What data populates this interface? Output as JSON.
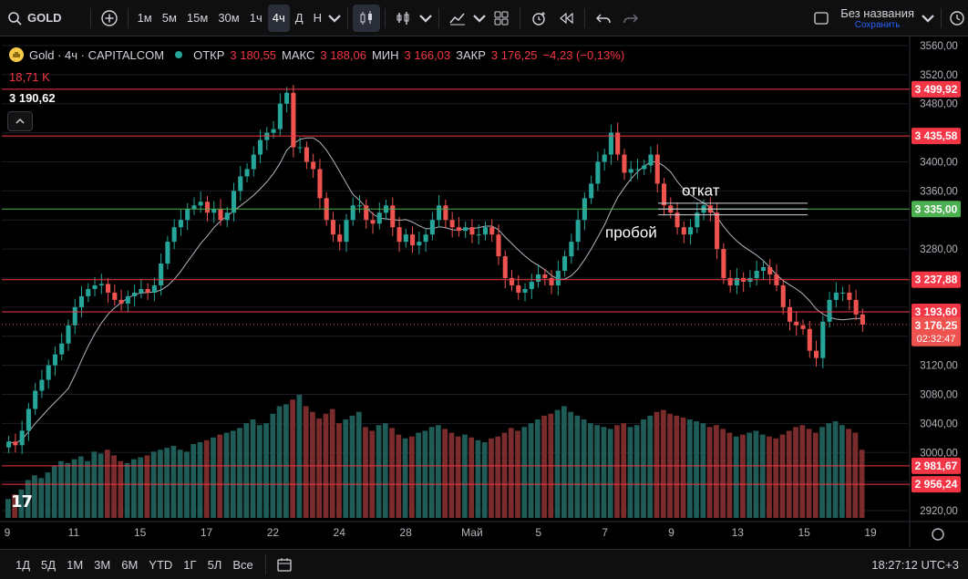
{
  "toolbar": {
    "symbol": "GOLD",
    "intervals": [
      "1м",
      "5м",
      "15м",
      "30м",
      "1ч",
      "4ч",
      "Д",
      "Н"
    ],
    "active_interval": "4ч",
    "layout_name": "Без названия",
    "save_label": "Сохранить"
  },
  "legend": {
    "title": "Gold · 4ч · CAPITALCOM",
    "open_label": "ОТКР",
    "open": "3 180,55",
    "high_label": "МАКС",
    "high": "3 188,06",
    "low_label": "МИН",
    "low": "3 166,03",
    "close_label": "ЗАКР",
    "close": "3 176,25",
    "change": "−4,23 (−0,13%)",
    "volume": "18,71 K",
    "crosshair_price": "3 190,62"
  },
  "annotations": {
    "pullback": "откат",
    "breakout": "пробой"
  },
  "bottom": {
    "ranges": [
      "1Д",
      "5Д",
      "1М",
      "3М",
      "6М",
      "YTD",
      "1Г",
      "5Л",
      "Все"
    ],
    "clock": "18:27:12 UTC+3"
  },
  "colors": {
    "up": "#26a69a",
    "down": "#ef5350",
    "level": "#f23645",
    "green_level": "#4caf50",
    "ma": "#b2b5be"
  },
  "chart_data": {
    "type": "candlestick",
    "y_axis": {
      "ylim": [
        2910,
        3570
      ],
      "ticks": [
        3560,
        3520,
        3480,
        3440,
        3400,
        3360,
        3320,
        3280,
        3240,
        3200,
        3160,
        3120,
        3080,
        3040,
        3000,
        2960,
        2920
      ],
      "tick_labels": [
        "3560,00",
        "3520,00",
        "3480,00",
        "3440,00",
        "3400,00",
        "3360,00",
        "3320,00",
        "3280,00",
        "3240,00",
        "3200,00",
        "3160,00",
        "3120,00",
        "3080,00",
        "3040,00",
        "3000,00",
        "2960,00",
        "2920,00"
      ]
    },
    "x_axis": {
      "labels": [
        "9",
        "11",
        "15",
        "17",
        "22",
        "24",
        "28",
        "Май",
        "5",
        "7",
        "9",
        "13",
        "15",
        "19"
      ]
    },
    "levels": [
      {
        "price": 3499.92,
        "label": "3 499,92",
        "color": "#f23645"
      },
      {
        "price": 3435.58,
        "label": "3 435,58",
        "color": "#f23645"
      },
      {
        "price": 3335.0,
        "label": "3 335,00",
        "color": "#4caf50"
      },
      {
        "price": 3237.88,
        "label": "3 237,88",
        "color": "#f23645"
      },
      {
        "price": 3193.6,
        "label": "3 193,60",
        "color": "#f23645"
      },
      {
        "price": 2981.67,
        "label": "2 981,67",
        "color": "#f23645"
      },
      {
        "price": 2956.24,
        "label": "2 956,24",
        "color": "#f23645"
      }
    ],
    "last_price": {
      "price": 3176.25,
      "label": "3 176,25",
      "countdown": "02:32:47"
    },
    "closes": [
      3015,
      3010,
      3030,
      3060,
      3085,
      3100,
      3120,
      3135,
      3150,
      3175,
      3200,
      3215,
      3225,
      3230,
      3232,
      3220,
      3210,
      3205,
      3215,
      3220,
      3225,
      3220,
      3230,
      3260,
      3290,
      3310,
      3320,
      3335,
      3340,
      3345,
      3330,
      3335,
      3320,
      3330,
      3360,
      3380,
      3390,
      3410,
      3430,
      3440,
      3445,
      3480,
      3495,
      3420,
      3420,
      3400,
      3390,
      3350,
      3320,
      3300,
      3290,
      3320,
      3340,
      3340,
      3320,
      3315,
      3330,
      3340,
      3310,
      3290,
      3300,
      3285,
      3290,
      3300,
      3320,
      3340,
      3320,
      3310,
      3305,
      3310,
      3300,
      3300,
      3310,
      3300,
      3270,
      3240,
      3230,
      3220,
      3225,
      3235,
      3245,
      3240,
      3230,
      3250,
      3270,
      3290,
      3320,
      3350,
      3370,
      3400,
      3410,
      3440,
      3410,
      3385,
      3390,
      3390,
      3395,
      3410,
      3370,
      3340,
      3330,
      3310,
      3300,
      3310,
      3330,
      3340,
      3330,
      3280,
      3240,
      3230,
      3240,
      3235,
      3240,
      3250,
      3255,
      3245,
      3230,
      3200,
      3180,
      3175,
      3170,
      3140,
      3130,
      3180,
      3210,
      3220,
      3220,
      3210,
      3190,
      3176
    ],
    "volumes": [
      20,
      25,
      30,
      40,
      45,
      42,
      48,
      55,
      60,
      58,
      62,
      65,
      60,
      70,
      68,
      72,
      66,
      60,
      58,
      62,
      64,
      66,
      70,
      72,
      74,
      76,
      72,
      70,
      78,
      80,
      82,
      85,
      88,
      90,
      92,
      95,
      100,
      104,
      98,
      100,
      110,
      118,
      120,
      125,
      130,
      118,
      112,
      105,
      110,
      115,
      100,
      104,
      108,
      112,
      96,
      92,
      98,
      100,
      95,
      88,
      84,
      86,
      90,
      92,
      96,
      98,
      94,
      90,
      86,
      88,
      85,
      82,
      80,
      84,
      86,
      90,
      95,
      92,
      96,
      100,
      104,
      108,
      110,
      114,
      118,
      112,
      108,
      104,
      100,
      98,
      96,
      94,
      98,
      100,
      96,
      98,
      104,
      108,
      112,
      114,
      110,
      108,
      106,
      104,
      102,
      100,
      96,
      98,
      94,
      90,
      86,
      88,
      90,
      92,
      88,
      86,
      84,
      88,
      92,
      96,
      98,
      94,
      90,
      96,
      100,
      102,
      98,
      94,
      90,
      72
    ]
  }
}
